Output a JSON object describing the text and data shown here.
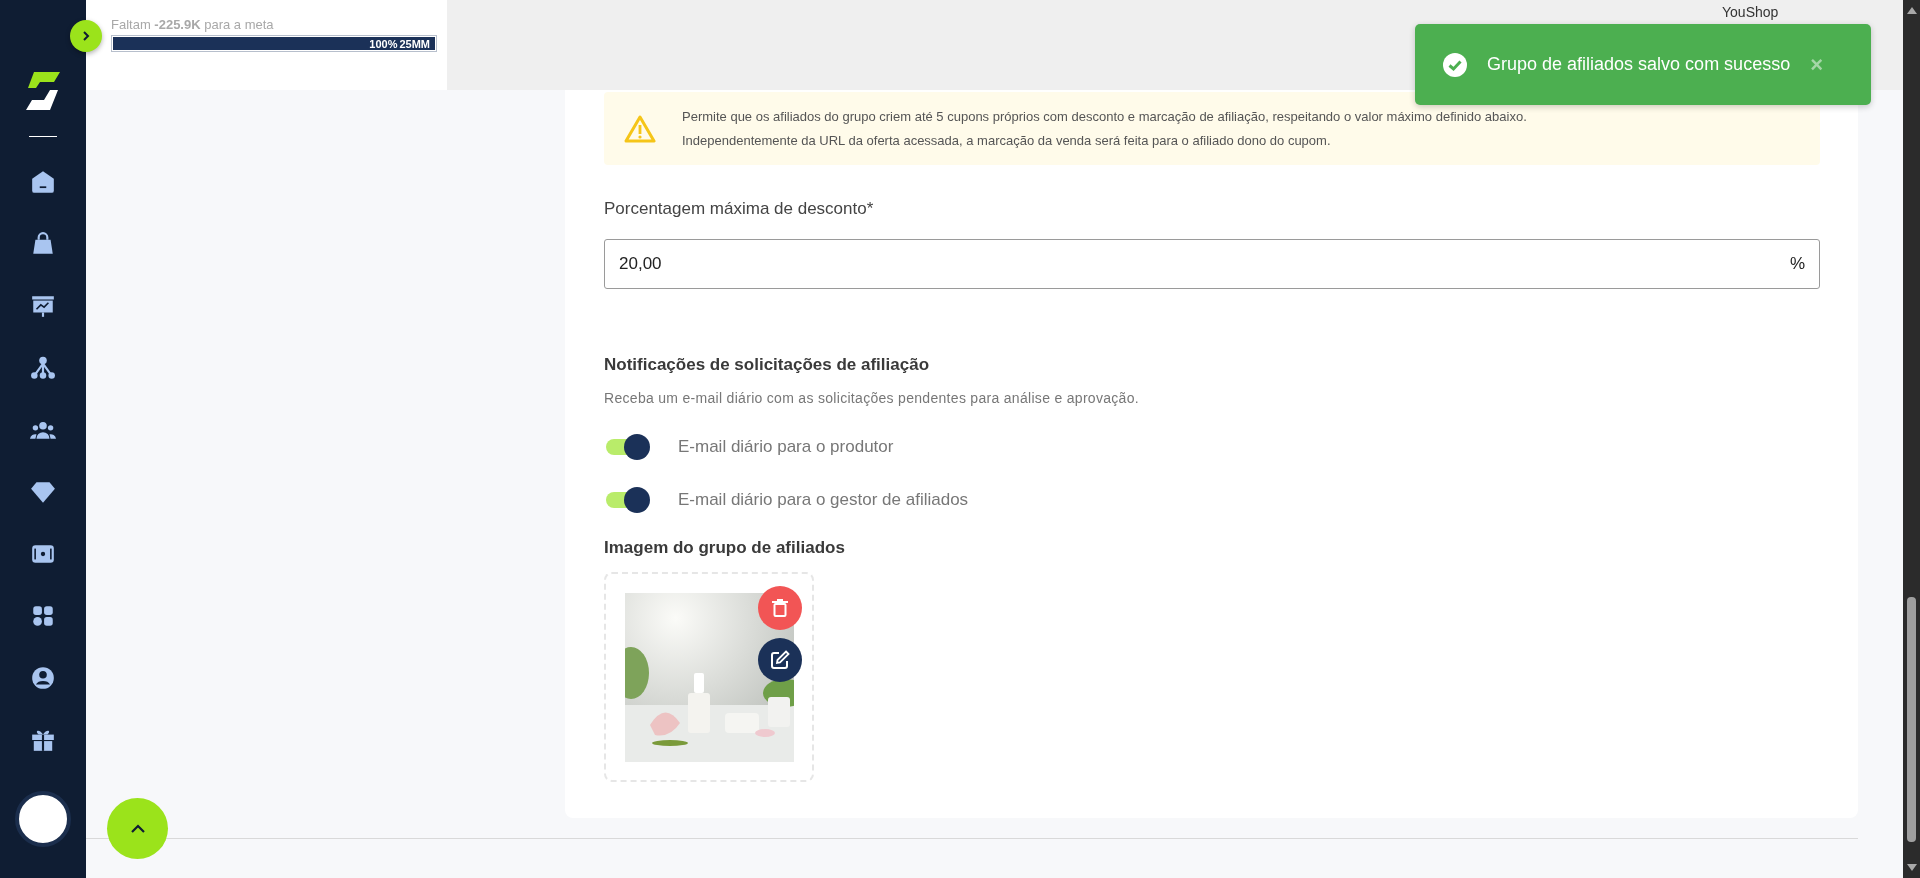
{
  "header": {
    "goal_text": "Faltam **-225.9K** para a meta",
    "progress": {
      "level": 1,
      "percent": "100%",
      "target": "25MM"
    },
    "account": "YouShop"
  },
  "toast": {
    "message": "Grupo de afiliados salvo com sucesso",
    "close": "×"
  },
  "warning": {
    "lines": [
      "Permite que os afiliados do grupo criem até 5 cupons próprios com desconto e marcação de afiliação, respeitando o valor máximo definido abaixo.",
      "Independentemente da URL da oferta acessada, a marcação da venda será feita para o afiliado dono do cupom."
    ]
  },
  "discount": {
    "label": "Porcentagem máxima de desconto*",
    "value": "20,00",
    "suffix": "%"
  },
  "notifications": {
    "title": "Notificações de solicitações de afiliação",
    "description": "Receba um e-mail diário com as solicitações pendentes para análise e aprovação.",
    "toggles": [
      {
        "label": "E-mail diário para o produtor",
        "on": true
      },
      {
        "label": "E-mail diário para o gestor de afiliados",
        "on": true
      }
    ]
  },
  "image": {
    "label": "Imagem do grupo de afiliados"
  }
}
